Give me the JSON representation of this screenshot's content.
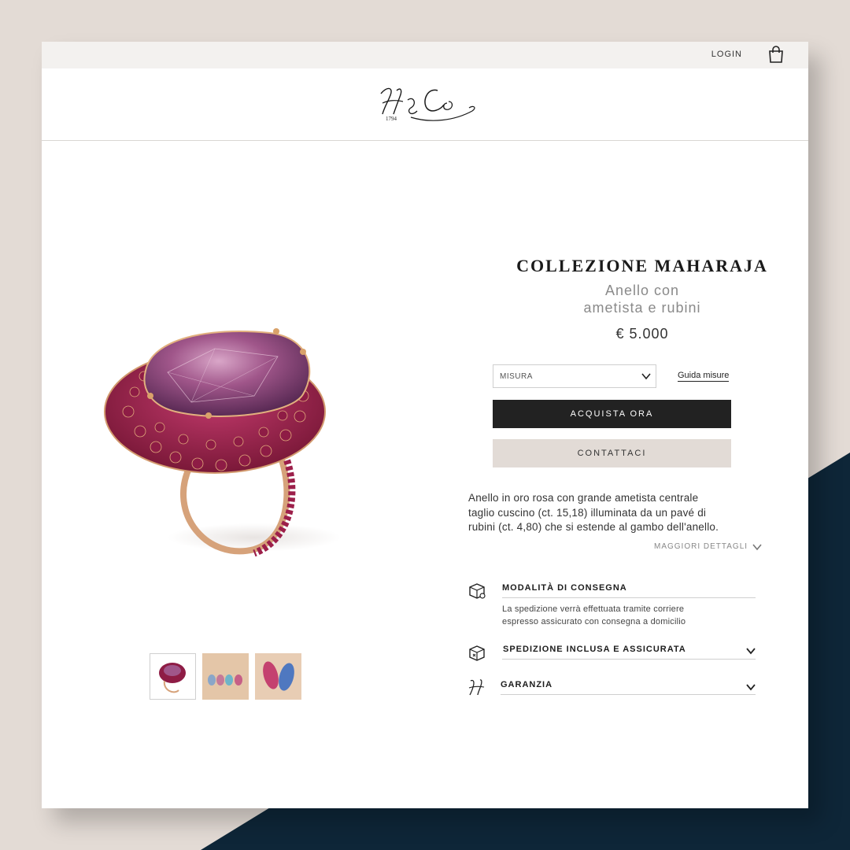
{
  "colors": {
    "page_background": "#e3dbd5",
    "navy_accent": "#0e2638",
    "buy_button": "#222222",
    "contact_button": "#e2dbd6"
  },
  "topbar": {
    "login_label": "LOGIN",
    "cart_icon": "shopping-bag-icon"
  },
  "header": {
    "logo_text": "H&Co",
    "logo_year": "1794"
  },
  "product": {
    "collection": "COLLEZIONE MAHARAJA",
    "subtitle_line1": "Anello con",
    "subtitle_line2": "ametista e rubini",
    "price": "€ 5.000",
    "size_select": {
      "selected": "MISURA"
    },
    "size_guide_label": "Guida misure",
    "buy_label": "ACQUISTA ORA",
    "contact_label": "CONTATTACI",
    "description_line1": "Anello in oro rosa con grande ametista centrale",
    "description_line2": "taglio cuscino (ct. 15,18) illuminata da un pavé di",
    "description_line3": "rubini (ct. 4,80) che si estende al gambo dell'anello.",
    "more_label": "MAGGIORI DETTAGLI"
  },
  "thumbnails": [
    {
      "name": "ring-front",
      "active": true
    },
    {
      "name": "rings-lineup",
      "active": false
    },
    {
      "name": "rings-pair",
      "active": false
    }
  ],
  "accordion": [
    {
      "title": "MODALITÀ DI CONSEGNA",
      "icon": "delivery-box-icon",
      "expanded": true,
      "body_line1": "La spedizione verrà effettuata tramite corriere",
      "body_line2": "espresso assicurato con consegna a domicilio"
    },
    {
      "title": "SPEDIZIONE INCLUSA E ASSICURATA",
      "icon": "insured-box-icon",
      "expanded": false
    },
    {
      "title": "GARANZIA",
      "icon": "monogram-h-icon",
      "expanded": false
    }
  ]
}
